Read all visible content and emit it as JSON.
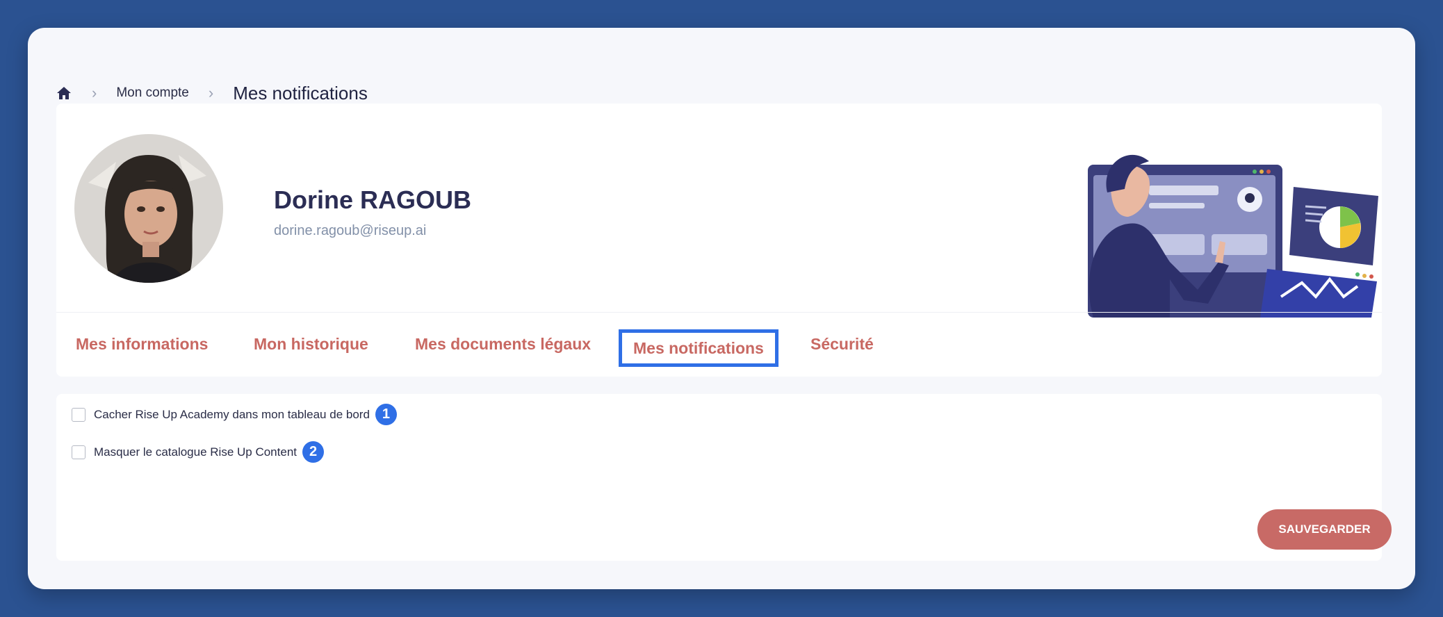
{
  "breadcrumb": {
    "home_icon": "home-icon",
    "separator_icon": "chevron-right-icon",
    "items": [
      "Mon compte",
      "Mes notifications"
    ]
  },
  "profile": {
    "name": "Dorine RAGOUB",
    "email": "dorine.ragoub@riseup.ai"
  },
  "tabs": [
    {
      "label": "Mes informations",
      "active": false
    },
    {
      "label": "Mon historique",
      "active": false
    },
    {
      "label": "Mes documents légaux",
      "active": false
    },
    {
      "label": "Mes notifications",
      "active": true
    },
    {
      "label": "Sécurité",
      "active": false
    }
  ],
  "options": [
    {
      "label": "Cacher Rise Up Academy dans mon tableau de bord",
      "checked": false,
      "badge": "1"
    },
    {
      "label": "Masquer le catalogue Rise Up Content",
      "checked": false,
      "badge": "2"
    }
  ],
  "actions": {
    "save_label": "SAUVEGARDER"
  },
  "colors": {
    "background": "#2b5291",
    "accent": "#c86862",
    "highlight": "#2f6fe6",
    "title": "#2b2d54"
  }
}
